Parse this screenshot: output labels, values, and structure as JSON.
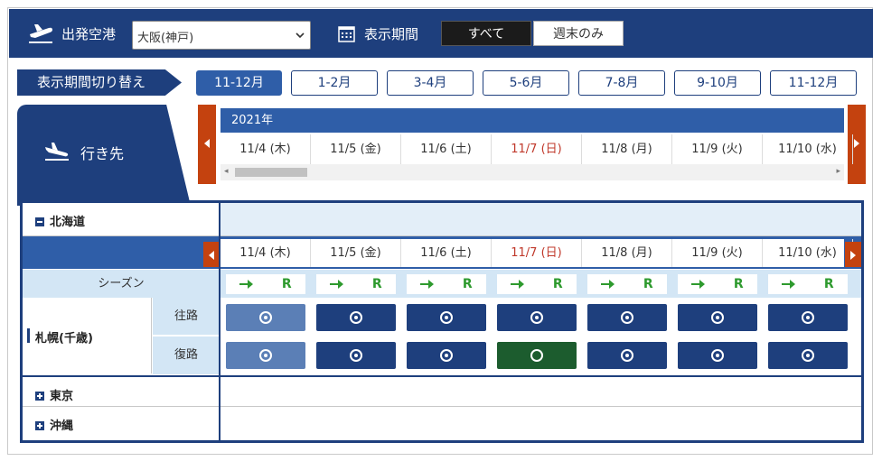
{
  "header": {
    "departure_label": "出発空港",
    "airport_value": "大阪(神戸)",
    "period_label": "表示期間",
    "filter_all": "すべて",
    "filter_weekend": "週末のみ"
  },
  "period_switch": {
    "label": "表示期間切り替え",
    "options": [
      "11-12月",
      "1-2月",
      "3-4月",
      "5-6月",
      "7-8月",
      "9-10月",
      "11-12月"
    ],
    "active_index": 0
  },
  "destination_tab": {
    "label": "行き先"
  },
  "calendar": {
    "year": "2021年",
    "dates": [
      {
        "label": "11/4 (木)",
        "sunday": false
      },
      {
        "label": "11/5 (金)",
        "sunday": false
      },
      {
        "label": "11/6 (土)",
        "sunday": false
      },
      {
        "label": "11/7 (日)",
        "sunday": true
      },
      {
        "label": "11/8 (月)",
        "sunday": false
      },
      {
        "label": "11/9 (火)",
        "sunday": false
      },
      {
        "label": "11/10 (水)",
        "sunday": false
      }
    ]
  },
  "regions": {
    "hokkaido": "北海道",
    "tokyo": "東京",
    "okinawa": "沖縄"
  },
  "season_label": "シーズン",
  "legend_r": "R",
  "sapporo": {
    "name": "札幌(千歳)",
    "outbound_label": "往路",
    "return_label": "復路",
    "outbound": [
      "available-light",
      "available",
      "available",
      "available",
      "available",
      "available",
      "available"
    ],
    "return": [
      "available-light",
      "available",
      "available",
      "open-green",
      "available",
      "available",
      "available"
    ]
  },
  "colors": {
    "navy": "#1e3f7d",
    "blue": "#2f5ea8",
    "arrow_orange": "#c4420f",
    "sunday_red": "#c0392b",
    "legend_green": "#2e9a2e",
    "pale_blue": "#d3e6f5"
  }
}
